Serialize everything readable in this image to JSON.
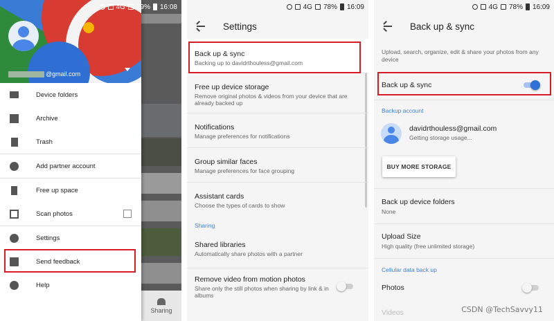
{
  "panel1": {
    "status": {
      "icons": [
        "alarm-icon",
        "image-icon",
        "warning-icon",
        "lte-icon",
        "wifi-icon",
        "signal-icon"
      ],
      "network": "4G",
      "battery": "79%",
      "time": "16:08"
    },
    "account": {
      "email_suffix": "@gmail.com"
    },
    "menu": [
      {
        "label": "Device folders",
        "icon": "folder-icon"
      },
      {
        "label": "Archive",
        "icon": "archive-icon"
      },
      {
        "label": "Trash",
        "icon": "trash-icon"
      },
      {
        "label": "Add partner account",
        "icon": "partner-icon"
      },
      {
        "label": "Free up space",
        "icon": "phone-icon"
      },
      {
        "label": "Scan photos",
        "icon": "scan-icon"
      },
      {
        "label": "Settings",
        "icon": "gear-icon"
      },
      {
        "label": "Send feedback",
        "icon": "feedback-icon"
      },
      {
        "label": "Help",
        "icon": "help-icon"
      }
    ],
    "sharing_label": "Sharing"
  },
  "panel2": {
    "status": {
      "network": "4G",
      "battery": "78%",
      "time": "16:09"
    },
    "title": "Settings",
    "items": [
      {
        "title": "Back up & sync",
        "subtitle": "Backing up to davidrthouless@gmail.com"
      },
      {
        "title": "Free up device storage",
        "subtitle": "Remove original photos & videos from your device that are already backed up"
      },
      {
        "title": "Notifications",
        "subtitle": "Manage preferences for notifications"
      },
      {
        "title": "Group similar faces",
        "subtitle": "Manage preferences for face grouping"
      },
      {
        "title": "Assistant cards",
        "subtitle": "Choose the types of cards to show"
      }
    ],
    "section_sharing": "Sharing",
    "sharing_items": [
      {
        "title": "Shared libraries",
        "subtitle": "Automatically share photos with a partner"
      },
      {
        "title": "Remove video from motion photos",
        "subtitle": "Share only the still photos when sharing by link & in albums",
        "toggle": false
      }
    ]
  },
  "panel3": {
    "status": {
      "network": "4G",
      "battery": "78%",
      "time": "16:09"
    },
    "title": "Back up & sync",
    "description": "Upload, search, organize, edit & share your photos from any device",
    "backup_toggle": {
      "label": "Back up & sync",
      "on": true
    },
    "section_account": "Backup account",
    "account_email": "davidrthouless@gmail.com",
    "account_status": "Getting storage usage...",
    "buy_button": "BUY MORE STORAGE",
    "device_folders": {
      "title": "Back up device folders",
      "subtitle": "None"
    },
    "upload_size": {
      "title": "Upload Size",
      "subtitle": "High quality (free unlimited storage)"
    },
    "section_cellular": "Cellular data back up",
    "photos": {
      "label": "Photos",
      "on": false
    },
    "videos": {
      "label": "Videos"
    }
  },
  "watermark": "CSDN @TechSavvy11",
  "colors": {
    "accent": "#2f6fd8",
    "highlight_border": "#d81c25",
    "section": "#3e7fdc"
  }
}
